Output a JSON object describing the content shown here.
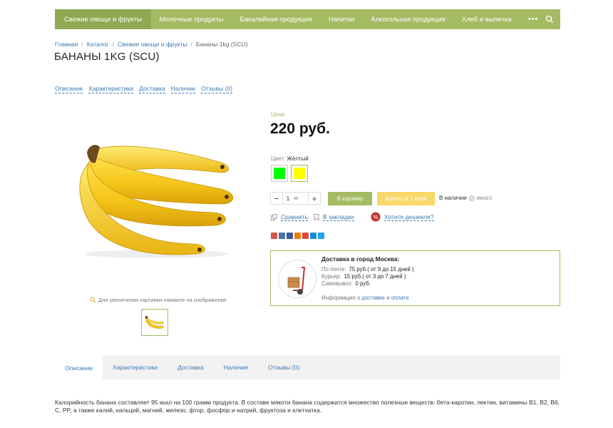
{
  "nav": {
    "items": [
      "Свежие овощи и фрукты",
      "Молочные продукты",
      "Бакалейная продукция",
      "Напитки",
      "Алкогольная продукция",
      "Хлеб и выпечка"
    ],
    "more": "•••",
    "search_icon": "search-icon"
  },
  "breadcrumb": {
    "items": [
      "Главная",
      "Каталог",
      "Свежие овощи и фрукты",
      "Бананы 1kg (SCU)"
    ],
    "separator": "/"
  },
  "product": {
    "title": "БАНАНЫ 1KG (SCU)",
    "price_label": "Цена",
    "price": "220 руб.",
    "color_label": "Цвет:",
    "color_value": "Жёлтый",
    "swatches": [
      "#00ff00",
      "#ffff00"
    ],
    "qty": "1",
    "unit": "кг",
    "add_to_cart": "В корзину",
    "one_click": "Купить в 1 клик",
    "stock": "В наличии",
    "stock_amount": "много",
    "compare": "Сравнить",
    "bookmarks": "В закладки",
    "cheaper": "Хотите дешевле?",
    "zoom_hint": "Для увеличения картинки нажмите на изображение"
  },
  "anchors": [
    "Описание",
    "Характеристики",
    "Доставка",
    "Наличие",
    "Отзывы (0)"
  ],
  "social_colors": [
    "#d9534f",
    "#4a76a8",
    "#3b5998",
    "#ee8208",
    "#dd4b39",
    "#168de2",
    "#1da1f2"
  ],
  "delivery": {
    "title": "Доставка в город Москва:",
    "rows": [
      {
        "label": "По почте:",
        "value": "75 руб.( от 9 до 15 дней )"
      },
      {
        "label": "Курьер:",
        "value": "15 руб.( от 3 до 7 дней )"
      },
      {
        "label": "Самовывоз:",
        "value": "0 руб."
      }
    ],
    "info_prefix": "Информация о",
    "info_link1": "доставке",
    "info_and": "и",
    "info_link2": "оплате"
  },
  "tabs": [
    "Описание",
    "Характеристики",
    "Доставка",
    "Наличие",
    "Отзывы (0)"
  ],
  "description": "Калорийность банана составляет 95 ккал на 100 грамм продукта. В составе мякоти банана содержатся множество полезные веществ: бета-каротин, пектин, витамины B1, B2, B6, C, PP, а также калий, кальций, магний, железо, фтор, фосфор и натрий, фруктоза и клетчатка."
}
